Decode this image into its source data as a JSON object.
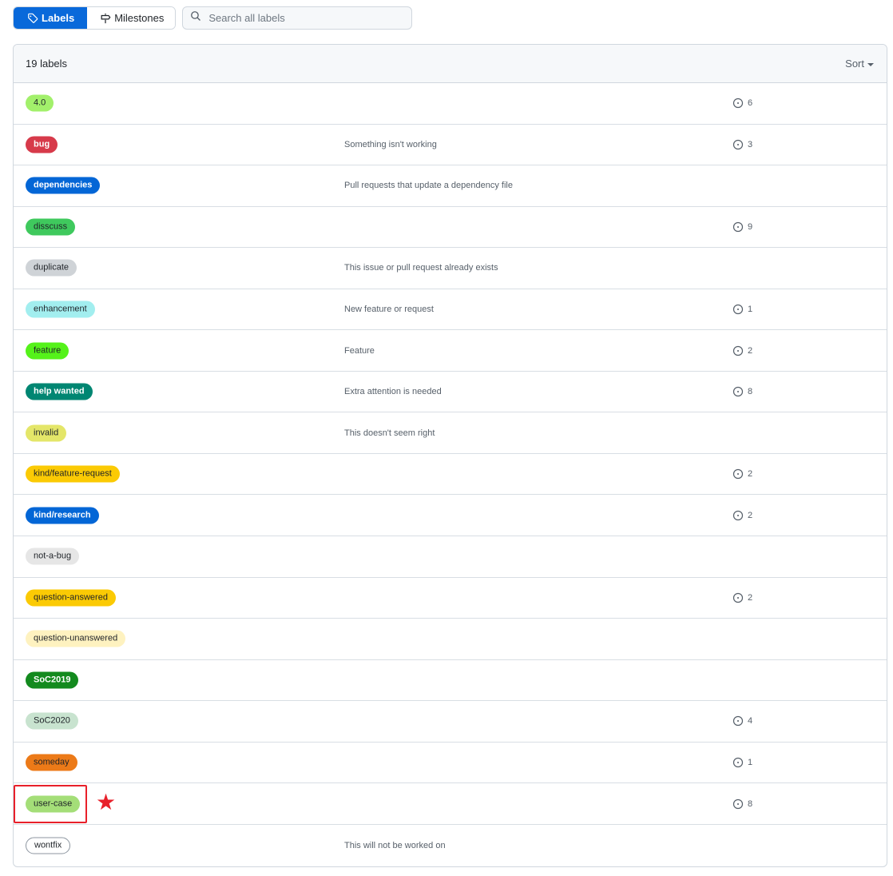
{
  "toolbar": {
    "tabs": [
      {
        "label": "Labels",
        "icon": "tag-icon",
        "active": true
      },
      {
        "label": "Milestones",
        "icon": "milestone-icon",
        "active": false
      }
    ],
    "search": {
      "placeholder": "Search all labels",
      "value": ""
    }
  },
  "list": {
    "count_label": "19 labels",
    "sort_label": "Sort",
    "labels": [
      {
        "name": "4.0",
        "description": "",
        "open_issues": "6",
        "bg": "#a2f06b",
        "fg": "#1f2328",
        "bold": false
      },
      {
        "name": "bug",
        "description": "Something isn't working",
        "open_issues": "3",
        "bg": "#d73a4a",
        "fg": "#ffffff",
        "bold": true
      },
      {
        "name": "dependencies",
        "description": "Pull requests that update a dependency file",
        "open_issues": "",
        "bg": "#0366d6",
        "fg": "#ffffff",
        "bold": true
      },
      {
        "name": "disscuss",
        "description": "",
        "open_issues": "9",
        "bg": "#3fc95d",
        "fg": "#1f2328",
        "bold": false
      },
      {
        "name": "duplicate",
        "description": "This issue or pull request already exists",
        "open_issues": "",
        "bg": "#cfd3d7",
        "fg": "#1f2328",
        "bold": false
      },
      {
        "name": "enhancement",
        "description": "New feature or request",
        "open_issues": "1",
        "bg": "#a2eeef",
        "fg": "#1f2328",
        "bold": false
      },
      {
        "name": "feature",
        "description": "Feature",
        "open_issues": "2",
        "bg": "#55f21a",
        "fg": "#1f2328",
        "bold": false
      },
      {
        "name": "help wanted",
        "description": "Extra attention is needed",
        "open_issues": "8",
        "bg": "#008672",
        "fg": "#ffffff",
        "bold": true
      },
      {
        "name": "invalid",
        "description": "This doesn't seem right",
        "open_issues": "",
        "bg": "#e4e669",
        "fg": "#1f2328",
        "bold": false
      },
      {
        "name": "kind/feature-request",
        "description": "",
        "open_issues": "2",
        "bg": "#fbca04",
        "fg": "#1f2328",
        "bold": false
      },
      {
        "name": "kind/research",
        "description": "",
        "open_issues": "2",
        "bg": "#0366d6",
        "fg": "#ffffff",
        "bold": true
      },
      {
        "name": "not-a-bug",
        "description": "",
        "open_issues": "",
        "bg": "#e6e6e6",
        "fg": "#1f2328",
        "bold": false
      },
      {
        "name": "question-answered",
        "description": "",
        "open_issues": "2",
        "bg": "#fbca04",
        "fg": "#1f2328",
        "bold": false
      },
      {
        "name": "question-unanswered",
        "description": "",
        "open_issues": "",
        "bg": "#fef2c0",
        "fg": "#1f2328",
        "bold": false
      },
      {
        "name": "SoC2019",
        "description": "",
        "open_issues": "",
        "bg": "#138a1e",
        "fg": "#ffffff",
        "bold": true
      },
      {
        "name": "SoC2020",
        "description": "",
        "open_issues": "4",
        "bg": "#c5def5",
        "fg": "#1f2328",
        "bold": false,
        "bg_override": "#c8e3cf"
      },
      {
        "name": "someday",
        "description": "",
        "open_issues": "1",
        "bg": "#ec7a18",
        "fg": "#1f2328",
        "bold": false
      },
      {
        "name": "user-case",
        "description": "",
        "open_issues": "8",
        "bg": "#a4de78",
        "fg": "#1f2328",
        "bold": false
      },
      {
        "name": "wontfix",
        "description": "This will not be worked on",
        "open_issues": "",
        "bg": "#ffffff",
        "fg": "#1f2328",
        "bold": false,
        "outlined": true
      }
    ]
  },
  "annotation": {
    "highlighted_label": "user-case",
    "marker": "★"
  }
}
